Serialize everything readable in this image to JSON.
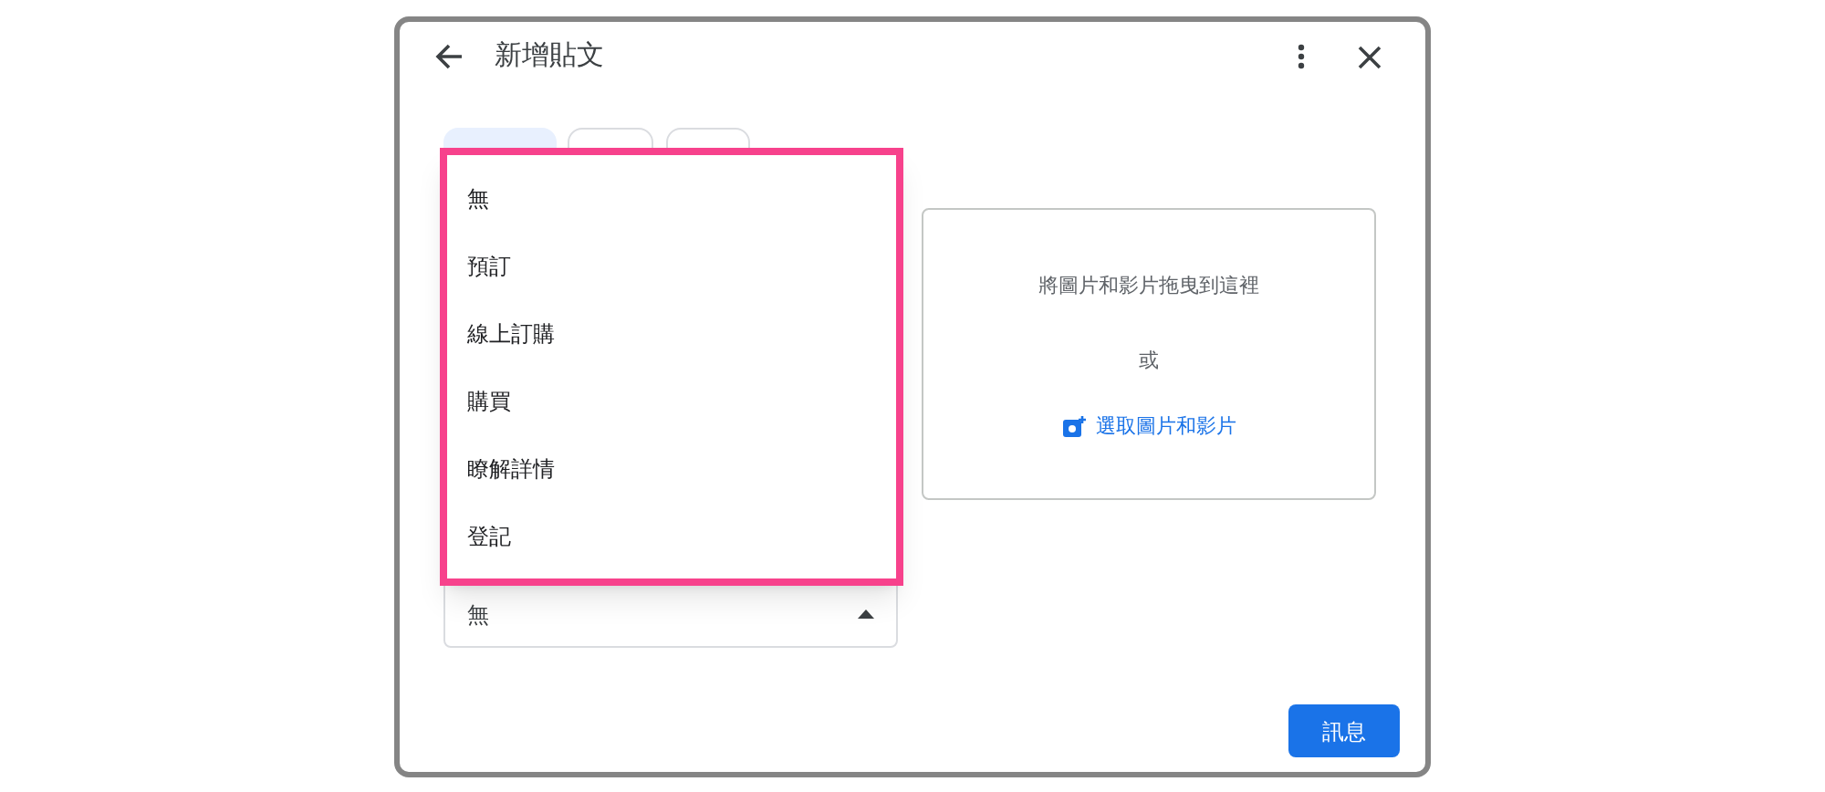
{
  "dialog": {
    "title": "新增貼文"
  },
  "tabs": [
    {
      "selected": true
    },
    {
      "selected": false
    },
    {
      "selected": false
    }
  ],
  "menu": {
    "items": [
      {
        "label": "無"
      },
      {
        "label": "預訂"
      },
      {
        "label": "線上訂購"
      },
      {
        "label": "購買"
      },
      {
        "label": "瞭解詳情"
      },
      {
        "label": "登記"
      }
    ]
  },
  "button_select": {
    "value": "無",
    "expanded": true
  },
  "media_drop": {
    "hint": "將圖片和影片拖曳到這裡",
    "separator": "或",
    "link": "選取圖片和影片"
  },
  "buttons": [
    "訊息"
  ]
}
